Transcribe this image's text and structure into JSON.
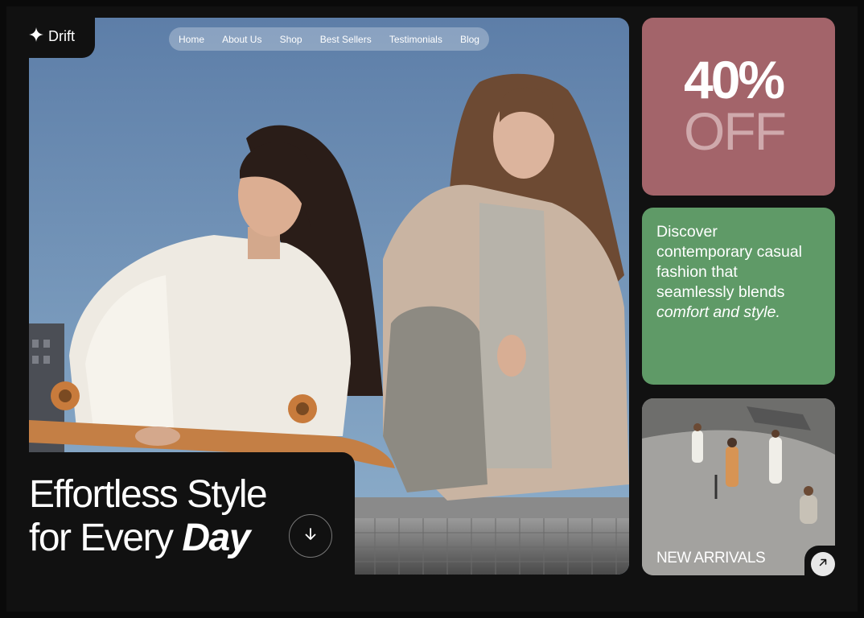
{
  "brand": {
    "name": "Drift",
    "icon": "sparkle-icon"
  },
  "nav": {
    "items": [
      "Home",
      "About Us",
      "Shop",
      "Best Sellers",
      "Testimonials",
      "Blog"
    ]
  },
  "hero": {
    "headline_line1": "Effortless Style",
    "headline_line2_plain": "for Every ",
    "headline_line2_emph": "Day",
    "scroll_icon": "arrow-down-icon"
  },
  "promo": {
    "amount": "40%",
    "label": "OFF",
    "color": "#a3646a"
  },
  "info": {
    "text_plain": "Discover contemporary casual fashion that seamlessly blends ",
    "text_emph": "comfort and style.",
    "color": "#5f9a67"
  },
  "arrivals": {
    "label": "NEW ARRIVALS",
    "arrow_icon": "arrow-up-right-icon"
  }
}
